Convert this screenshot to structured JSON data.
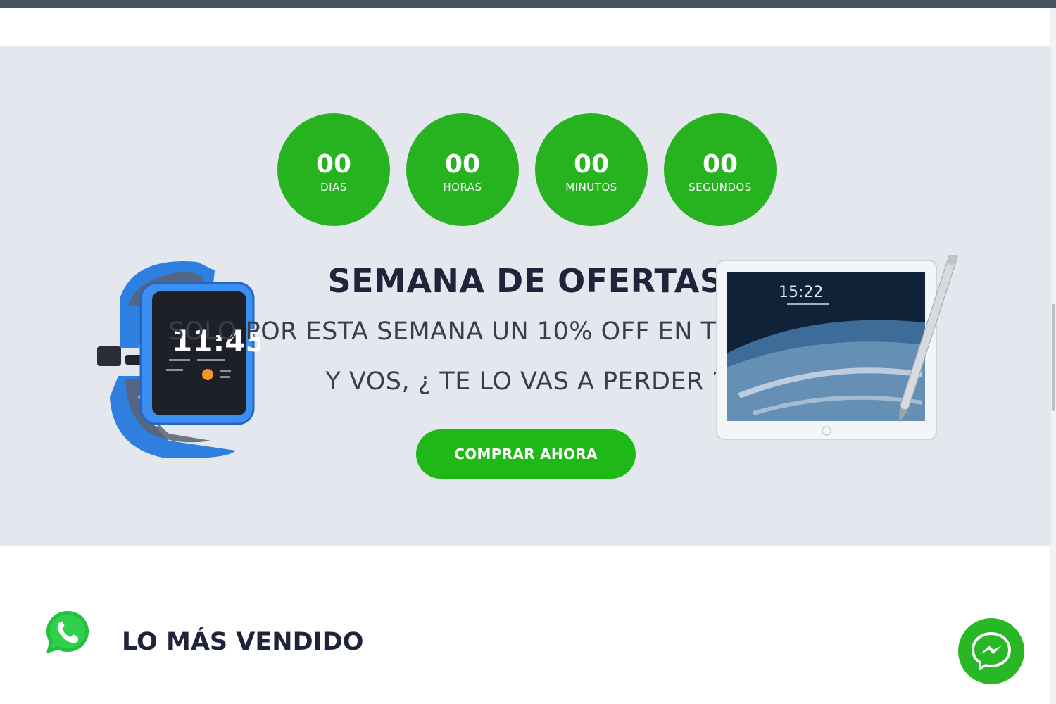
{
  "countdown": [
    {
      "value": "00",
      "label": "DIAS"
    },
    {
      "value": "00",
      "label": "HORAS"
    },
    {
      "value": "00",
      "label": "MINUTOS"
    },
    {
      "value": "00",
      "label": "SEGUNDOS"
    }
  ],
  "hero": {
    "title": "SEMANA DE OFERTAS",
    "line1": "SOLO POR ESTA SEMANA UN 10% OFF EN TUS COMPRAS",
    "line2": "Y VOS, ¿ TE LO VAS A PERDER ?",
    "button_label": "COMPRAR AHORA",
    "watch_time": "11:45",
    "tablet_time": "15:22"
  },
  "best_sellers": {
    "title": "LO MÁS VENDIDO"
  },
  "icons": {
    "whatsapp": "whatsapp-icon",
    "messenger": "messenger-icon"
  },
  "colors": {
    "accent_green": "#26b31f",
    "hero_background": "#e4e7ee",
    "top_bar": "#45545f",
    "heading_text": "#20243a"
  }
}
